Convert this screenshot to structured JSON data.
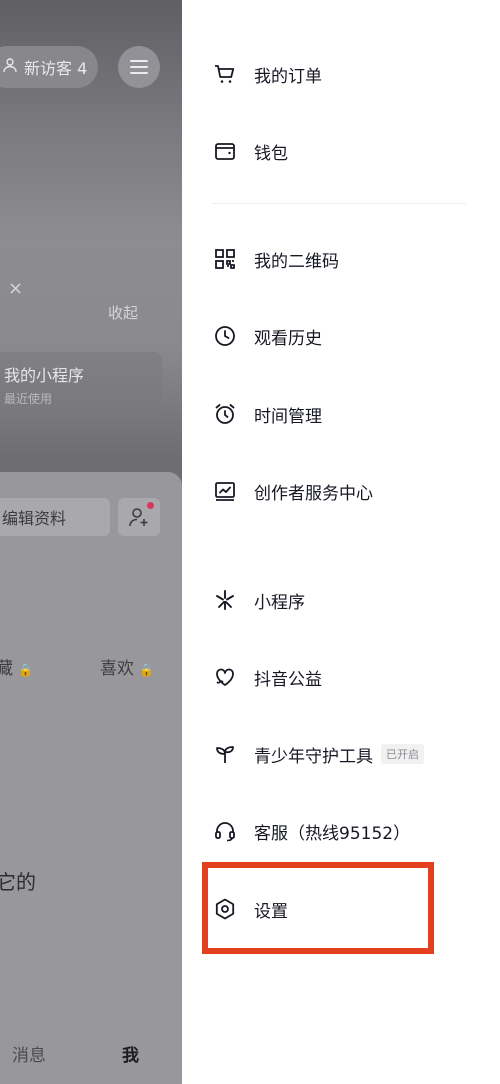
{
  "background": {
    "visitor_pill": {
      "icon": "user-icon",
      "label": "新访客 4"
    },
    "collapse_label": "收起",
    "close_glyph": "×",
    "mini_card": {
      "title": "我的小程序",
      "subtitle": "最近使用"
    },
    "edit_profile_label": "编辑资料",
    "tab_favorites": "藏",
    "tab_likes": "喜欢",
    "partial_text": "它的",
    "nav_messages": "消息",
    "nav_me": "我"
  },
  "drawer": {
    "items": [
      {
        "label": "我的订单",
        "icon": "cart-icon"
      },
      {
        "label": "钱包",
        "icon": "wallet-icon"
      },
      {
        "label": "我的二维码",
        "icon": "qrcode-icon"
      },
      {
        "label": "观看历史",
        "icon": "clock-icon"
      },
      {
        "label": "时间管理",
        "icon": "alarm-icon"
      },
      {
        "label": "创作者服务中心",
        "icon": "chart-icon"
      },
      {
        "label": "小程序",
        "icon": "asterisk-icon"
      },
      {
        "label": "抖音公益",
        "icon": "heart-hand-icon"
      },
      {
        "label": "青少年守护工具",
        "icon": "sprout-icon",
        "badge": "已开启"
      },
      {
        "label": "客服（热线95152）",
        "icon": "headset-icon"
      },
      {
        "label": "设置",
        "icon": "settings-icon"
      }
    ],
    "highlight_color": "#e2401f"
  }
}
